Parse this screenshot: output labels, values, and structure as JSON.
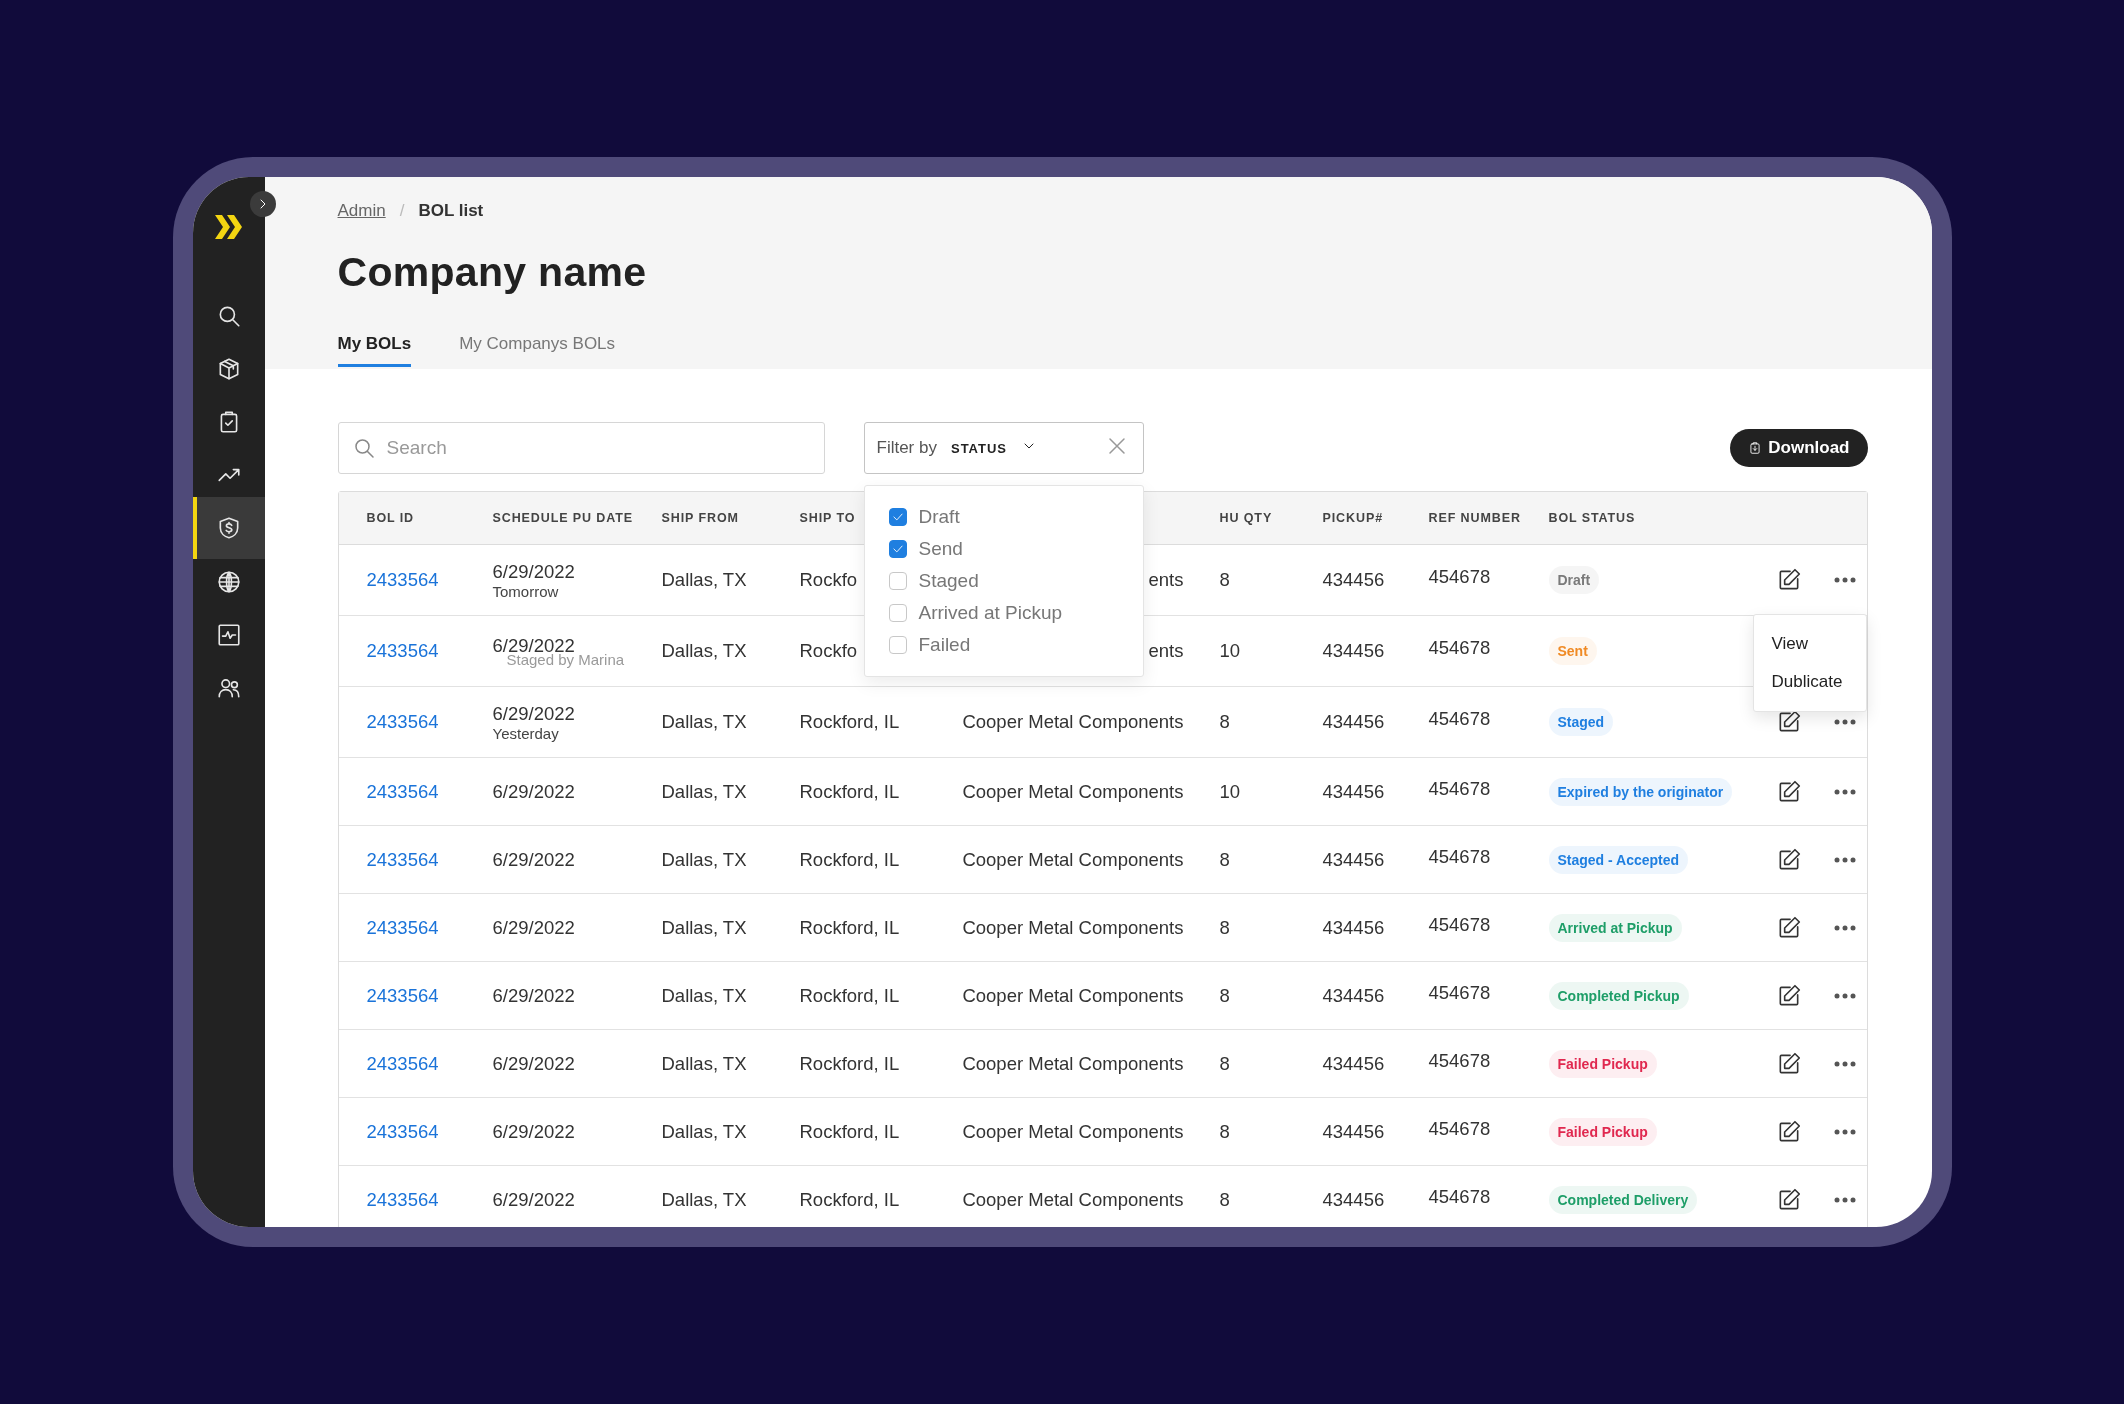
{
  "sidebar": {
    "items": [
      {
        "kind": "search",
        "selected": false
      },
      {
        "kind": "cube",
        "selected": false
      },
      {
        "kind": "clipboard",
        "selected": false
      },
      {
        "kind": "trend",
        "selected": false
      },
      {
        "kind": "shield",
        "selected": true
      },
      {
        "kind": "globe",
        "selected": false
      },
      {
        "kind": "monitor",
        "selected": false
      },
      {
        "kind": "users",
        "selected": false
      }
    ]
  },
  "breadcrumb": {
    "items": [
      "Admin",
      "BOL list"
    ],
    "separator": "/"
  },
  "title": "Company name",
  "tabs": [
    {
      "label": "My BOLs",
      "selected": true
    },
    {
      "label": "My Companys BOLs",
      "selected": false
    }
  ],
  "search": {
    "placeholder": "Search"
  },
  "filter": {
    "label": "Filter by",
    "value": "STATUS",
    "open": true,
    "options": [
      {
        "label": "Draft",
        "checked": true
      },
      {
        "label": "Send",
        "checked": true
      },
      {
        "label": "Staged",
        "checked": false
      },
      {
        "label": "Arrived at Pickup",
        "checked": false
      },
      {
        "label": "Failed",
        "checked": false
      }
    ]
  },
  "download_button": "Download",
  "table": {
    "columns": [
      "BOL ID",
      "SCHEDULE PU DATE",
      "SHIP FROM",
      "SHIP TO",
      "HU QTY",
      "PICKUP#",
      "REF NUMBER",
      "BOL STATUS"
    ],
    "row_menu": [
      "View",
      "Dublicate"
    ],
    "rows": [
      {
        "bol_id": "2433564",
        "date": "6/29/2022",
        "sub": "Tomorrow",
        "ship_from": "Dallas, TX",
        "ship_to": "Rockfo",
        "carrier": "ents",
        "hu_qty": "8",
        "pickup": "434456",
        "ref": "454678",
        "status": {
          "label": "Draft",
          "color": "#7a7a7a"
        },
        "menu_open": false
      },
      {
        "bol_id": "2433564",
        "date": "6/29/2022",
        "note": "Staged by Marina",
        "ship_from": "Dallas, TX",
        "ship_to": "Rockfo",
        "carrier": "ents",
        "hu_qty": "10",
        "pickup": "434456",
        "ref": "454678",
        "status": {
          "label": "Sent",
          "color": "#f08a24"
        },
        "menu_open": true
      },
      {
        "bol_id": "2433564",
        "date": "6/29/2022",
        "sub": "Yesterday",
        "ship_from": "Dallas, TX",
        "ship_to": "Rockford, IL",
        "carrier": "Cooper Metal Components",
        "hu_qty": "8",
        "pickup": "434456",
        "ref": "454678",
        "status": {
          "label": "Staged",
          "color": "#1f7fe0"
        },
        "menu_open": false
      },
      {
        "bol_id": "2433564",
        "date": "6/29/2022",
        "ship_from": "Dallas, TX",
        "ship_to": "Rockford, IL",
        "carrier": "Cooper Metal Components",
        "hu_qty": "10",
        "pickup": "434456",
        "ref": "454678",
        "status": {
          "label": "Expired by the originator",
          "color": "#1f7fe0"
        },
        "menu_open": false
      },
      {
        "bol_id": "2433564",
        "date": "6/29/2022",
        "ship_from": "Dallas, TX",
        "ship_to": "Rockford, IL",
        "carrier": "Cooper Metal Components",
        "hu_qty": "8",
        "pickup": "434456",
        "ref": "454678",
        "status": {
          "label": "Staged - Accepted",
          "color": "#1f7fe0"
        },
        "menu_open": false
      },
      {
        "bol_id": "2433564",
        "date": "6/29/2022",
        "ship_from": "Dallas, TX",
        "ship_to": "Rockford, IL",
        "carrier": "Cooper Metal Components",
        "hu_qty": "8",
        "pickup": "434456",
        "ref": "454678",
        "status": {
          "label": "Arrived at Pickup",
          "color": "#1e9e68"
        },
        "menu_open": false
      },
      {
        "bol_id": "2433564",
        "date": "6/29/2022",
        "ship_from": "Dallas, TX",
        "ship_to": "Rockford, IL",
        "carrier": "Cooper Metal Components",
        "hu_qty": "8",
        "pickup": "434456",
        "ref": "454678",
        "status": {
          "label": "Completed Pickup",
          "color": "#1e9e68"
        },
        "menu_open": false
      },
      {
        "bol_id": "2433564",
        "date": "6/29/2022",
        "ship_from": "Dallas, TX",
        "ship_to": "Rockford, IL",
        "carrier": "Cooper Metal Components",
        "hu_qty": "8",
        "pickup": "434456",
        "ref": "454678",
        "status": {
          "label": "Failed Pickup",
          "color": "#e0284f"
        },
        "menu_open": false
      },
      {
        "bol_id": "2433564",
        "date": "6/29/2022",
        "ship_from": "Dallas, TX",
        "ship_to": "Rockford, IL",
        "carrier": "Cooper Metal Components",
        "hu_qty": "8",
        "pickup": "434456",
        "ref": "454678",
        "status": {
          "label": "Failed Pickup",
          "color": "#e0284f"
        },
        "menu_open": false
      },
      {
        "bol_id": "2433564",
        "date": "6/29/2022",
        "ship_from": "Dallas, TX",
        "ship_to": "Rockford, IL",
        "carrier": "Cooper Metal Components",
        "hu_qty": "8",
        "pickup": "434456",
        "ref": "454678",
        "status": {
          "label": "Completed Delivery",
          "color": "#1e9e68"
        },
        "menu_open": false
      }
    ]
  }
}
